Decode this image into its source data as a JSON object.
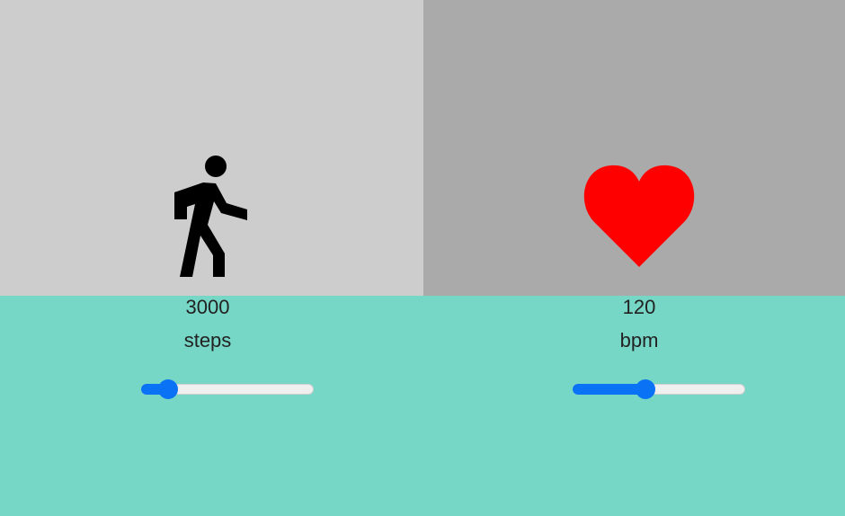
{
  "colors": {
    "left_panel": "#cdcdcd",
    "right_panel": "#aaaaaa",
    "bottom_area": "#77d7c6",
    "slider_accent": "#0a73f5",
    "heart": "#ff0000",
    "walk_icon": "#000000"
  },
  "steps": {
    "icon": "walking-person-icon",
    "value": "3000",
    "unit": "steps",
    "slider_fraction": 0.11
  },
  "heart_rate": {
    "icon": "heart-icon",
    "value": "120",
    "unit": "bpm",
    "slider_fraction": 0.41
  }
}
